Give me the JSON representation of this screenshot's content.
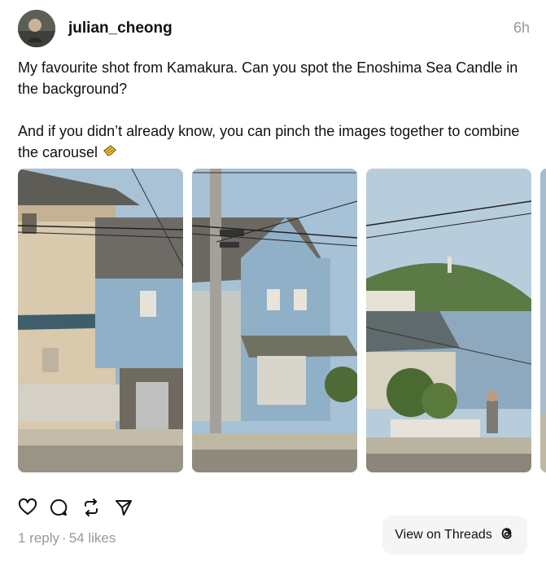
{
  "post": {
    "username": "julian_cheong",
    "time": "6h",
    "caption_line1": "My favourite shot from Kamakura. Can you spot the Enoshima Sea Candle in the background?",
    "caption_line2": "And if you didn’t already know, you can pinch the images together to combine the carousel"
  },
  "stats": {
    "replies": "1 reply",
    "separator": "·",
    "likes": "54 likes"
  },
  "view_button": {
    "label": "View on Threads"
  },
  "icons": {
    "like": "heart-icon",
    "reply": "comment-icon",
    "repost": "repost-icon",
    "share": "send-icon",
    "pinch": "pinch-hand-icon",
    "threads": "threads-logo-icon"
  }
}
